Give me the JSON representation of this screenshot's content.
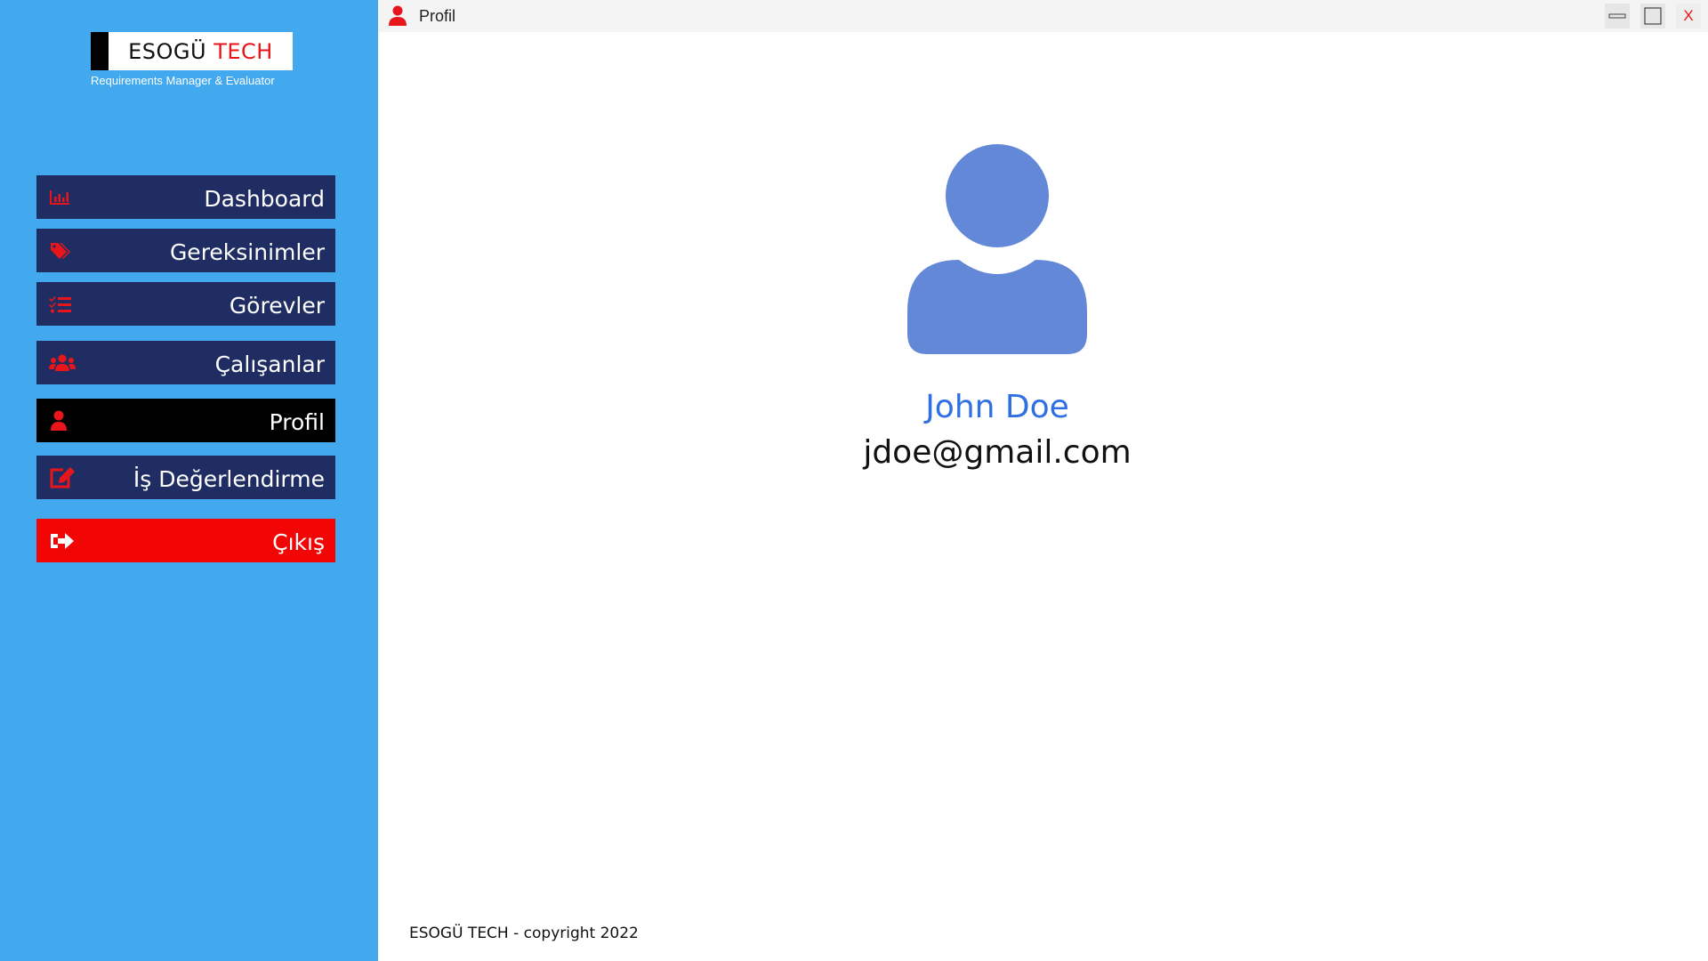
{
  "brand": {
    "name_part1": "ESOGÜ",
    "name_part2": "TECH",
    "subtitle": "Requirements Manager & Evaluator",
    "accent_color": "#e8161b"
  },
  "sidebar": {
    "background_color": "#42a9ef",
    "items": [
      {
        "label": "Dashboard",
        "icon": "bar-chart-icon"
      },
      {
        "label": "Gereksinimler",
        "icon": "tags-icon"
      },
      {
        "label": "Görevler",
        "icon": "task-list-icon"
      },
      {
        "label": "Çalışanlar",
        "icon": "users-icon"
      },
      {
        "label": "Profil",
        "icon": "user-icon",
        "active": true
      },
      {
        "label": "İş Değerlendirme",
        "icon": "edit-icon"
      },
      {
        "label": "Çıkış",
        "icon": "sign-out-icon"
      }
    ]
  },
  "window": {
    "title": "Profil",
    "close_label": "X"
  },
  "profile": {
    "name": "John Doe",
    "email": "jdoe@gmail.com",
    "avatar_color": "#6488d8"
  },
  "footer": {
    "text": "ESOGÜ TECH - copyright 2022"
  }
}
